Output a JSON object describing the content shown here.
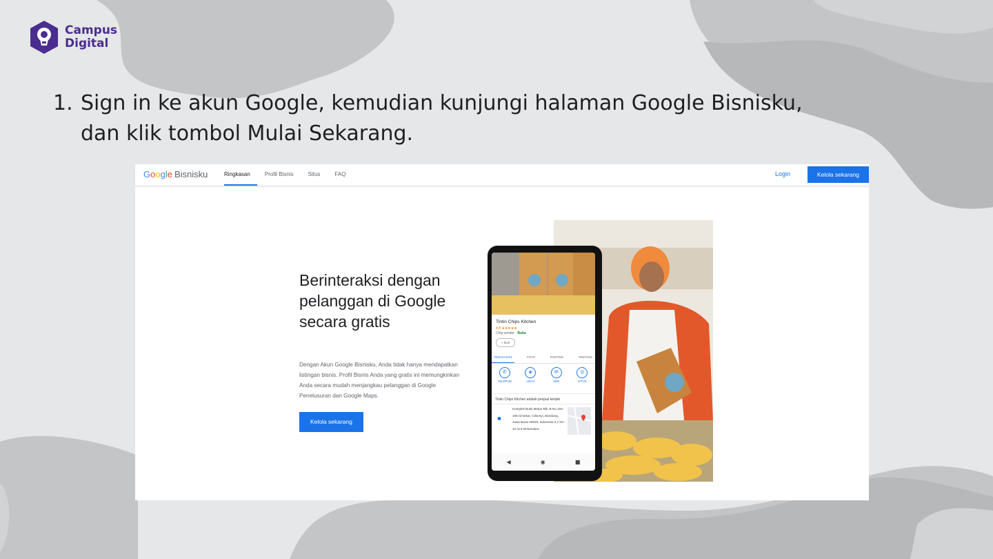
{
  "logo": {
    "line1": "Campus",
    "line2": "Digital"
  },
  "step": {
    "number": "1.",
    "text": "Sign in ke akun Google, kemudian kunjungi halaman Google Bisnisku, dan klik tombol Mulai Sekarang."
  },
  "screenshot": {
    "brand": {
      "g": "G",
      "o1": "o",
      "o2": "o",
      "g2": "g",
      "l": "l",
      "e": "e",
      "product": "Bisnisku"
    },
    "nav": [
      "Ringkasan",
      "Profil Bisnis",
      "Situs",
      "FAQ"
    ],
    "login": "Login",
    "top_button": "Kelola sekarang",
    "headline": "Berinteraksi dengan pelanggan di Google secara gratis",
    "body": "Dengan Akun Google Bisnisku, Anda tidak hanya mendapatkan listingan bisnis. Profil Bisnis Anda yang gratis ini memungkinkan Anda secara mudah menjangkau pelanggan di Google Penelusuran dan Google Maps.",
    "cta": "Kelola sekarang",
    "phone": {
      "business_name": "Tintin Chips Kitchen",
      "rating": "4,8 ★★★★★",
      "category": "Chip vendor ·",
      "status": "Buka",
      "follow": "+ Ikuti",
      "tabs": [
        "RINGKASAN",
        "FOTO",
        "POSTING",
        "TENTANG"
      ],
      "actions": [
        {
          "icon": "phone-icon",
          "label": "TELEPON",
          "glyph": "✆"
        },
        {
          "icon": "directions-icon",
          "label": "ARAH",
          "glyph": "◈"
        },
        {
          "icon": "sms-icon",
          "label": "SMS",
          "glyph": "✉"
        },
        {
          "icon": "website-icon",
          "label": "SITUS",
          "glyph": "◎"
        }
      ],
      "description": "Tintin Chips Kitchen adalah penjual keripik",
      "address": "Komplek Bukit Mekar Blk. B No.194-195 Cimekar, Cileunyi, Bandung, Jawa Barat 40628, Indonesia 3,7 km · 10 mnt berkendara",
      "navbar": [
        "◀",
        "◉",
        "■"
      ]
    }
  },
  "colors": {
    "logo": "#4a2d8f",
    "google_blue": "#1a73e8"
  }
}
